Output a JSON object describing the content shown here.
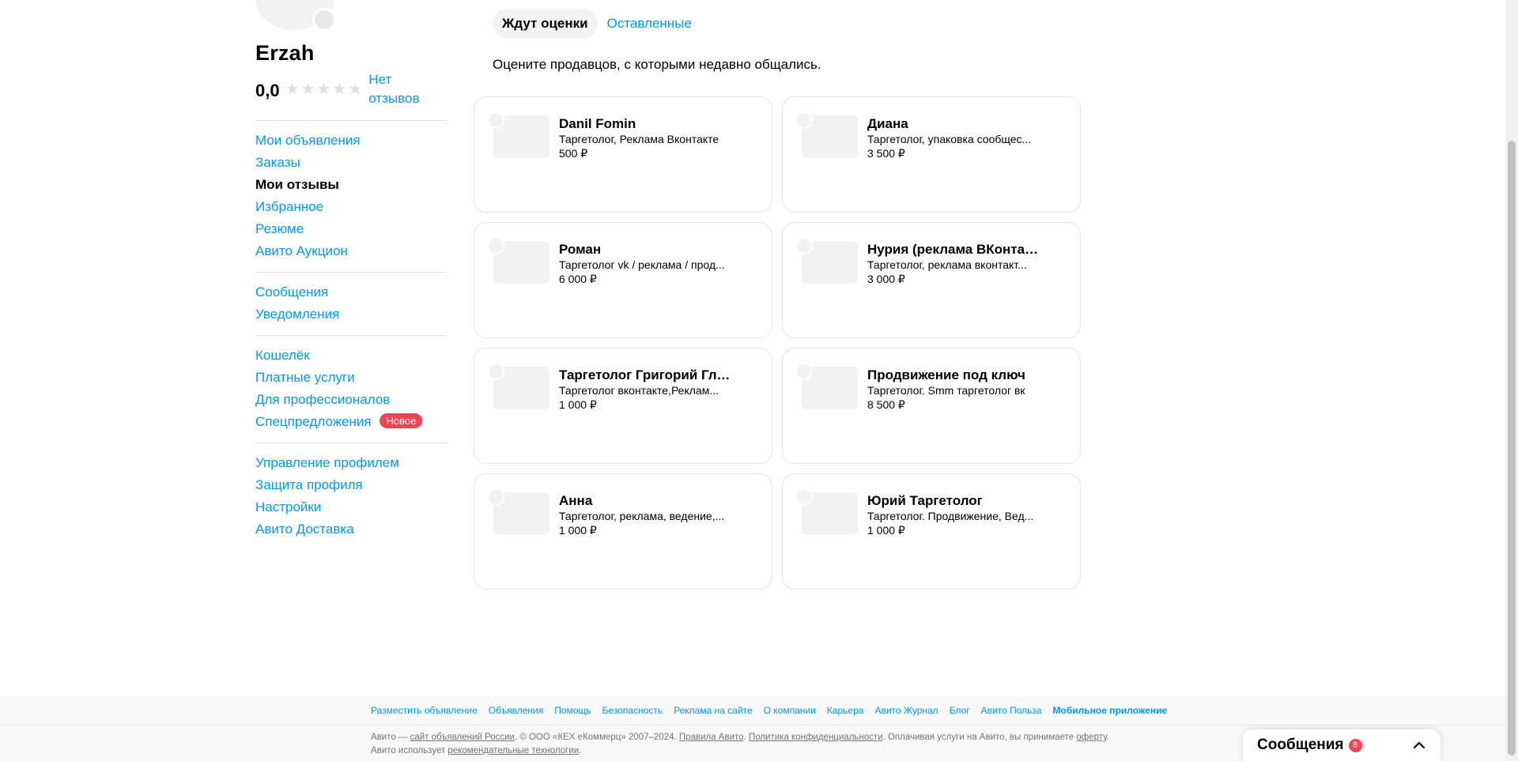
{
  "profile": {
    "username": "Erzah",
    "rating": "0,0",
    "stars": [
      "★",
      "★",
      "★",
      "★",
      "★"
    ],
    "no_reviews": "Нет отзывов"
  },
  "nav": {
    "group1": [
      "Мои объявления",
      "Заказы",
      "Мои отзывы",
      "Избранное",
      "Резюме",
      "Авито Аукцион"
    ],
    "group2": [
      "Сообщения",
      "Уведомления"
    ],
    "group3": [
      "Кошелёк",
      "Платные услуги",
      "Для профессионалов",
      "Спецпредложения"
    ],
    "group3_badge": "Новое",
    "group4": [
      "Управление профилем",
      "Защита профиля",
      "Настройки",
      "Авито Доставка"
    ]
  },
  "tabs": {
    "waiting": "Ждут оценки",
    "left": "Оставленные"
  },
  "subtitle": "Оцените продавцов, с которыми недавно общались.",
  "cards": [
    {
      "name": "Danil Fomin",
      "desc": "Таргетолог, Реклама Вконтакте",
      "price": "500 ₽"
    },
    {
      "name": "Диана",
      "desc": "Таргетолог, упаковка сообщес...",
      "price": "3 500 ₽"
    },
    {
      "name": "Роман",
      "desc": "Таргетолог vk / реклама / прод...",
      "price": "6 000 ₽"
    },
    {
      "name": "Нурия (реклама ВКонтакт...",
      "desc": "Таргетолог, реклама вконтакт...",
      "price": "3 000 ₽"
    },
    {
      "name": "Таргетолог Григорий Глух...",
      "desc": "Таргетолог вконтакте,Реклам...",
      "price": "1 000 ₽"
    },
    {
      "name": "Продвижение под ключ",
      "desc": "Таргетолог. Smm таргетолог вк",
      "price": "8 500 ₽"
    },
    {
      "name": "Анна",
      "desc": "Таргетолог, реклама, ведение,...",
      "price": "1 000 ₽"
    },
    {
      "name": "Юрий Таргетолог",
      "desc": "Таргетолог. Продвижение, Вед...",
      "price": "1 000 ₽"
    }
  ],
  "footer": {
    "links": [
      "Разместить объявление",
      "Объявления",
      "Помощь",
      "Безопасность",
      "Реклама на сайте",
      "О компании",
      "Карьера",
      "Авито Журнал",
      "Блог",
      "Авито Польза",
      "Мобильное приложение"
    ],
    "text_1": "Авито — ",
    "text_link_1": "сайт объявлений России",
    "text_2": ". © ООО «КЕХ еКоммерц» 2007–2024. ",
    "text_link_2": "Правила Авито",
    "text_3": ". ",
    "text_link_3": "Политика конфиденциальности",
    "text_4": ". Оплачивая услуги на Авито, вы принимаете ",
    "text_link_4": "оферту",
    "text_5": ". Авито использует ",
    "text_link_5": "рекомендательные технологии",
    "text_6": "."
  },
  "messages": {
    "title": "Сообщения",
    "count": "8"
  }
}
